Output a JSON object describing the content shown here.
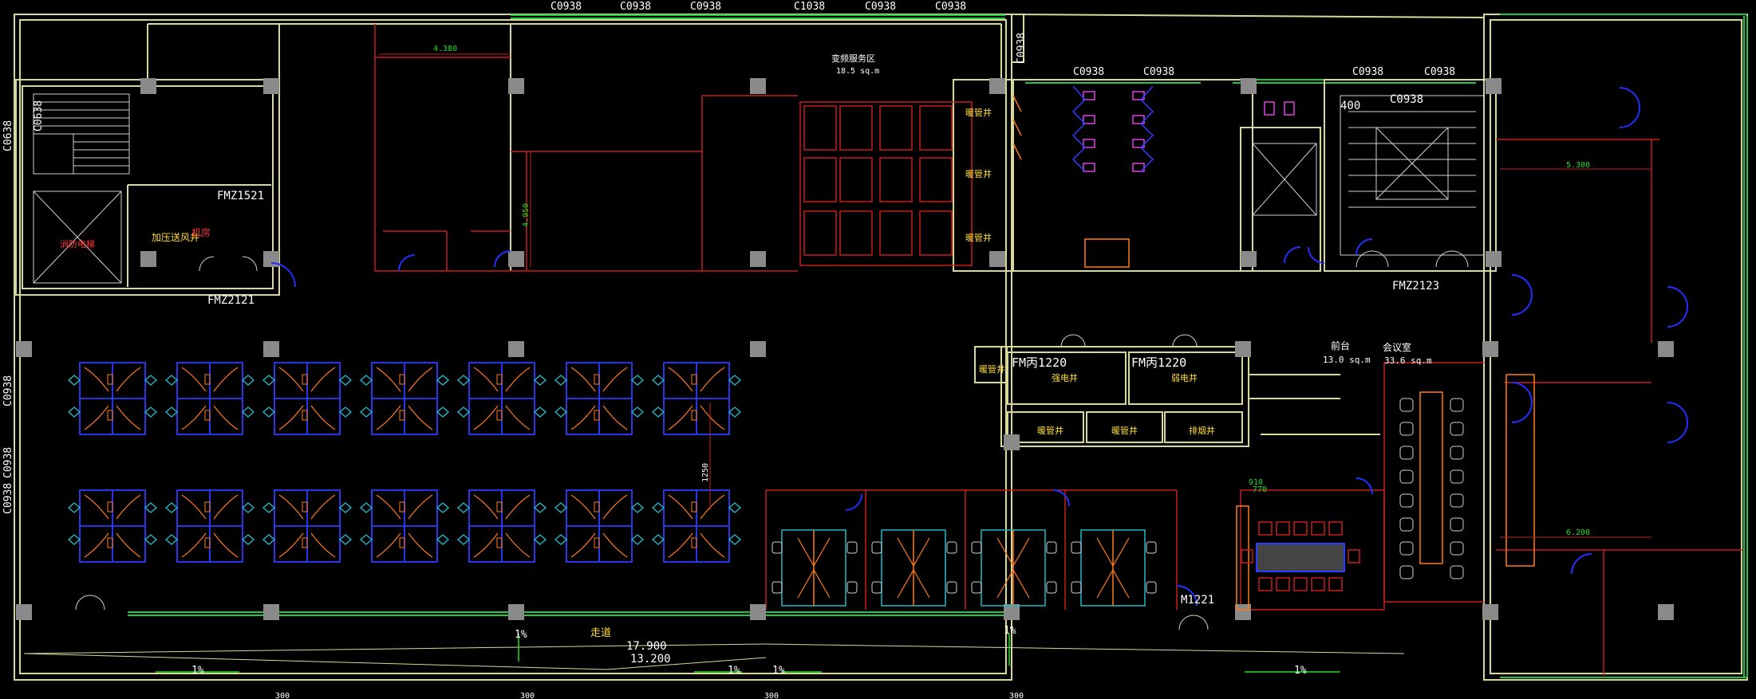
{
  "drawing": {
    "background": "#000000",
    "colors": {
      "wall": "#d8d89a",
      "column": "#8a8a8a",
      "partition": "#c81e1e",
      "glazing": "#22c83c",
      "door": "#2030ff",
      "stair": "#d0d0d0",
      "workstation_blue": "#2c3cff",
      "chair_cyan": "#22b8c8",
      "magenta": "#e040e0",
      "orange": "#ff7a1a"
    }
  },
  "windows_top": [
    "C0938",
    "C0938",
    "C0938",
    "C1038",
    "C0938",
    "C0938"
  ],
  "windows_top_right": [
    "C0938",
    "C0938",
    "C0938",
    "C0938"
  ],
  "windows_left": [
    "C0638",
    "C0938",
    "C0938",
    "C0938"
  ],
  "labels": {
    "stair_top_window": "C0638",
    "door_fmz1521": "FMZ1521",
    "door_fmz2121": "FMZ2121",
    "door_fmz2123": "FMZ2123",
    "room_pressure": "加压送风井",
    "room_fire_lift": "消防电梯",
    "room_machine": "机房",
    "room_core": "变频服务区",
    "room_core_area": "18.5 sq.m",
    "fm1": "FM丙1220",
    "fm2": "FM丙1220",
    "shaft_1": "强电井",
    "shaft_2": "弱电井",
    "shaft_3": "暖管井",
    "shaft_4": "暖管井",
    "shaft_5": "排烟井",
    "shaft_left_1": "暖管井",
    "shaft_left_2": "暖管井",
    "shaft_left_3": "暖管井",
    "shaft_left_4": "暖管井",
    "tea_room": "前台",
    "tea_room_area": "13.0 sq.m",
    "meeting_big": "会议室",
    "meeting_big_area": "33.6 sq.m",
    "door_m1221": "M1221",
    "window_c0938_stair": "C0938",
    "window_c0938_right": "C0938",
    "num_400": "400",
    "corridor": "走道",
    "elev_1": "17.900",
    "elev_2": "13.200",
    "slope_1": "1%",
    "slope_2": "1%",
    "slope_3": "1%",
    "slope_4": "1%",
    "slope_5": "1%",
    "slope_6": "1%",
    "dim_4380": "4.380",
    "dim_4950": "4.950",
    "dim_1250": "1250",
    "dim_5300": "5.300",
    "dim_6200": "6.200",
    "dim_910": "910",
    "dim_770": "770",
    "dim_300_a": "300",
    "dim_300_b": "300",
    "dim_300_c": "300",
    "dim_300_d": "300"
  }
}
